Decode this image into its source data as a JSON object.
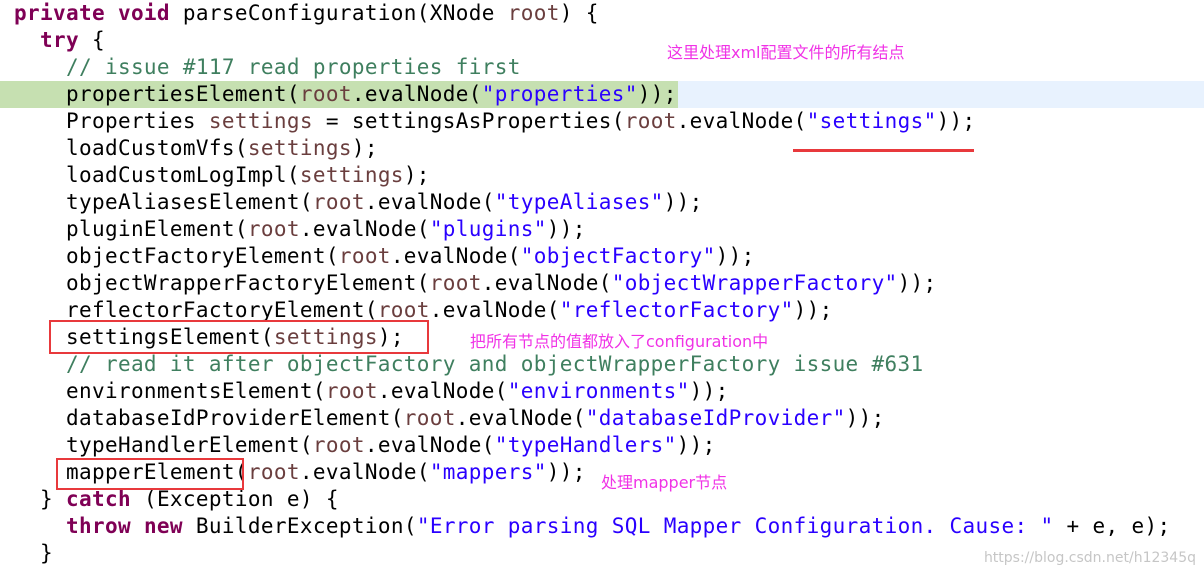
{
  "annotations": {
    "note1": "这里处理xml配置文件的所有结点",
    "note2": "把所有节点的值都放入了configuration中",
    "note3": "处理mapper节点"
  },
  "watermark": "https://blog.csdn.net/h12345q",
  "lines": [
    {
      "t": [
        [
          "kw",
          "private void "
        ],
        [
          "p",
          "parseConfiguration(XNode "
        ],
        [
          "var",
          "root"
        ],
        [
          "p",
          ") {"
        ]
      ]
    },
    {
      "t": [
        [
          "p",
          "  "
        ],
        [
          "kw",
          "try"
        ],
        [
          "p",
          " {"
        ]
      ]
    },
    {
      "t": [
        [
          "cmt",
          "    // issue #117 read properties first"
        ]
      ]
    },
    {
      "t": [
        [
          "p",
          "    propertiesElement("
        ],
        [
          "var",
          "root"
        ],
        [
          "p",
          ".evalNode("
        ],
        [
          "str",
          "\"properties\""
        ],
        [
          "p",
          "));"
        ]
      ]
    },
    {
      "t": [
        [
          "p",
          "    Properties "
        ],
        [
          "var",
          "settings"
        ],
        [
          "p",
          " = settingsAsProperties("
        ],
        [
          "var",
          "root"
        ],
        [
          "p",
          ".evalNode("
        ],
        [
          "str",
          "\"settings\""
        ],
        [
          "p",
          "));"
        ]
      ]
    },
    {
      "t": [
        [
          "p",
          "    loadCustomVfs("
        ],
        [
          "var",
          "settings"
        ],
        [
          "p",
          ");"
        ]
      ]
    },
    {
      "t": [
        [
          "p",
          "    loadCustomLogImpl("
        ],
        [
          "var",
          "settings"
        ],
        [
          "p",
          ");"
        ]
      ]
    },
    {
      "t": [
        [
          "p",
          "    typeAliasesElement("
        ],
        [
          "var",
          "root"
        ],
        [
          "p",
          ".evalNode("
        ],
        [
          "str",
          "\"typeAliases\""
        ],
        [
          "p",
          "));"
        ]
      ]
    },
    {
      "t": [
        [
          "p",
          "    pluginElement("
        ],
        [
          "var",
          "root"
        ],
        [
          "p",
          ".evalNode("
        ],
        [
          "str",
          "\"plugins\""
        ],
        [
          "p",
          "));"
        ]
      ]
    },
    {
      "t": [
        [
          "p",
          "    objectFactoryElement("
        ],
        [
          "var",
          "root"
        ],
        [
          "p",
          ".evalNode("
        ],
        [
          "str",
          "\"objectFactory\""
        ],
        [
          "p",
          "));"
        ]
      ]
    },
    {
      "t": [
        [
          "p",
          "    objectWrapperFactoryElement("
        ],
        [
          "var",
          "root"
        ],
        [
          "p",
          ".evalNode("
        ],
        [
          "str",
          "\"objectWrapperFactory\""
        ],
        [
          "p",
          "));"
        ]
      ]
    },
    {
      "t": [
        [
          "p",
          "    reflectorFactoryElement("
        ],
        [
          "var",
          "root"
        ],
        [
          "p",
          ".evalNode("
        ],
        [
          "str",
          "\"reflectorFactory\""
        ],
        [
          "p",
          "));"
        ]
      ]
    },
    {
      "t": [
        [
          "p",
          "    settingsElement("
        ],
        [
          "var",
          "settings"
        ],
        [
          "p",
          ");"
        ]
      ]
    },
    {
      "t": [
        [
          "cmt",
          "    // read it after objectFactory and objectWrapperFactory issue #631"
        ]
      ]
    },
    {
      "t": [
        [
          "p",
          "    environmentsElement("
        ],
        [
          "var",
          "root"
        ],
        [
          "p",
          ".evalNode("
        ],
        [
          "str",
          "\"environments\""
        ],
        [
          "p",
          "));"
        ]
      ]
    },
    {
      "t": [
        [
          "p",
          "    databaseIdProviderElement("
        ],
        [
          "var",
          "root"
        ],
        [
          "p",
          ".evalNode("
        ],
        [
          "str",
          "\"databaseIdProvider\""
        ],
        [
          "p",
          "));"
        ]
      ]
    },
    {
      "t": [
        [
          "p",
          "    typeHandlerElement("
        ],
        [
          "var",
          "root"
        ],
        [
          "p",
          ".evalNode("
        ],
        [
          "str",
          "\"typeHandlers\""
        ],
        [
          "p",
          "));"
        ]
      ]
    },
    {
      "t": [
        [
          "p",
          "    mapperElement("
        ],
        [
          "var",
          "root"
        ],
        [
          "p",
          ".evalNode("
        ],
        [
          "str",
          "\"mappers\""
        ],
        [
          "p",
          "));"
        ]
      ]
    },
    {
      "t": [
        [
          "p",
          "  } "
        ],
        [
          "kw",
          "catch"
        ],
        [
          "p",
          " (Exception e) {"
        ]
      ]
    },
    {
      "t": [
        [
          "p",
          "    "
        ],
        [
          "kw",
          "throw new"
        ],
        [
          "p",
          " BuilderException("
        ],
        [
          "str",
          "\"Error parsing SQL Mapper Configuration. Cause: \""
        ],
        [
          "p",
          " + e, e);"
        ]
      ]
    },
    {
      "t": [
        [
          "p",
          "  }"
        ]
      ]
    }
  ]
}
